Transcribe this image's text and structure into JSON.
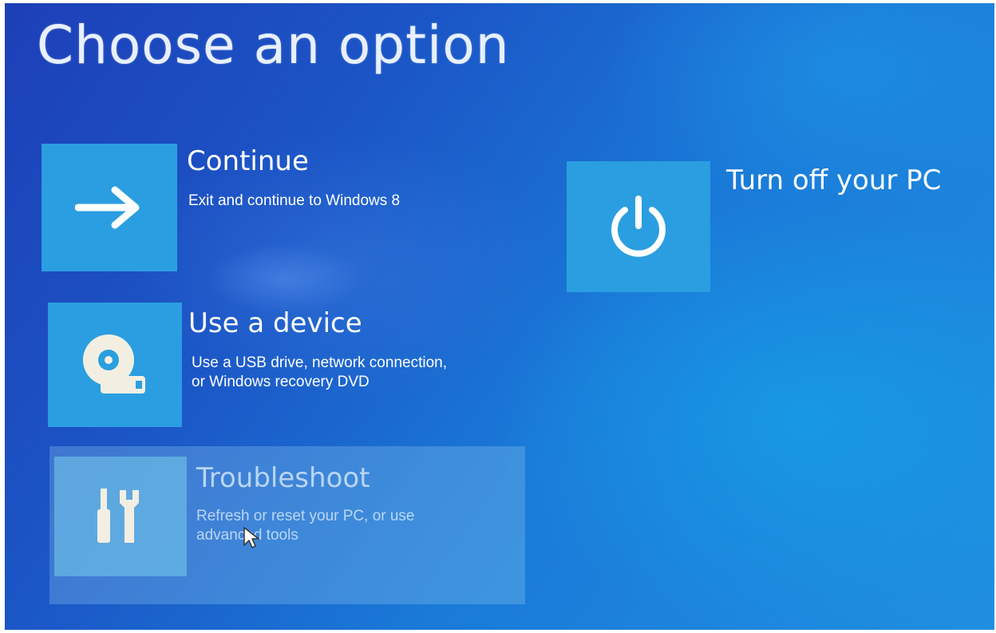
{
  "page": {
    "title": "Choose an option"
  },
  "options": [
    {
      "title": "Continue",
      "desc_line1": "Exit and continue to Windows 8",
      "desc_line2": "",
      "icon": "arrow-right-icon"
    },
    {
      "title": "Use a device",
      "desc_line1": "Use a USB drive, network connection,",
      "desc_line2": "or Windows recovery DVD",
      "icon": "disc-drive-icon"
    },
    {
      "title": "Troubleshoot",
      "desc_line1": "Refresh or reset your PC, or use",
      "desc_line2": "advanced tools",
      "icon": "tools-icon"
    },
    {
      "title": "Turn off your PC",
      "desc_line1": "",
      "desc_line2": "",
      "icon": "power-icon"
    }
  ],
  "colors": {
    "background": "#1b55c6",
    "tile": "#2a9ee0",
    "text": "#ffffff"
  }
}
